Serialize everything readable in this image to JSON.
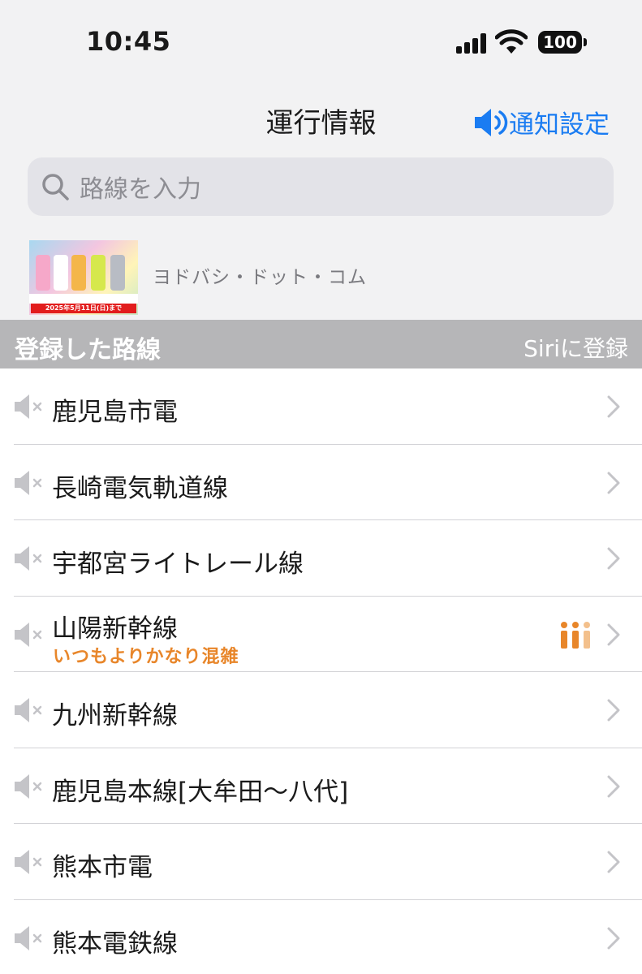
{
  "status_bar": {
    "time": "10:45",
    "battery": "100"
  },
  "nav": {
    "title": "運行情報",
    "notify_label": "通知設定"
  },
  "search": {
    "placeholder": "路線を入力"
  },
  "ad": {
    "date_text": "2025年5月11日(日)まで",
    "source": "ヨドバシ・ドット・コム"
  },
  "section": {
    "label": "登録した路線",
    "siri": "Siriに登録"
  },
  "routes": [
    {
      "name": "鹿児島市電",
      "status": ""
    },
    {
      "name": "長崎電気軌道線",
      "status": ""
    },
    {
      "name": "宇都宮ライトレール線",
      "status": ""
    },
    {
      "name": "山陽新幹線",
      "status": "いつもよりかなり混雑",
      "crowd": true
    },
    {
      "name": "九州新幹線",
      "status": ""
    },
    {
      "name": "鹿児島本線[大牟田〜八代]",
      "status": ""
    },
    {
      "name": "熊本市電",
      "status": ""
    },
    {
      "name": "熊本電鉄線",
      "status": ""
    }
  ],
  "colors": {
    "accent": "#1a7cf2",
    "crowd": "#e8862a",
    "section_bg": "#b6b6b8"
  }
}
